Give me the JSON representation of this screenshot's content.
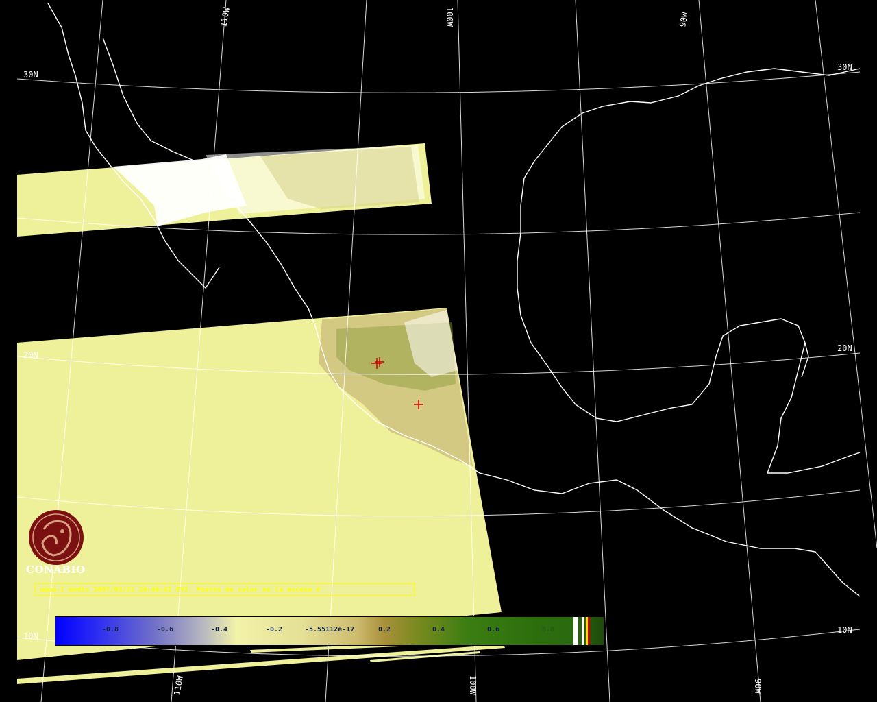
{
  "map": {
    "grid_labels": {
      "lon_top_110": "110W",
      "lon_top_100": "100W",
      "lon_top_90": "90W",
      "lon_bottom_110": "110W",
      "lon_bottom_100": "100W",
      "lon_bottom_90": "90W",
      "lat_left_30": "30N",
      "lat_right_30": "30N",
      "lat_left_20": "20N",
      "lat_right_20": "20N",
      "lat_left_10": "10N",
      "lat_right_10": "10N"
    },
    "hotspot_markers": 3,
    "colors": {
      "background": "#000000",
      "coastline": "#ffffff",
      "swath_fill": "#eff19a",
      "marker": "#cc0000",
      "caption": "#ffff00",
      "logo": "#7a1010"
    }
  },
  "caption": "aqua-1 modis 2007/03/21 20:46:41 EVI. Puntos de calor en la escena 6",
  "colorbar": {
    "labels": [
      "-0.8",
      "-0.6",
      "-0.4",
      "-0.2",
      "-5.55112e-17",
      "0.2",
      "0.4",
      "0.6",
      "0.8"
    ]
  },
  "logo": {
    "name": "CONABIO"
  }
}
